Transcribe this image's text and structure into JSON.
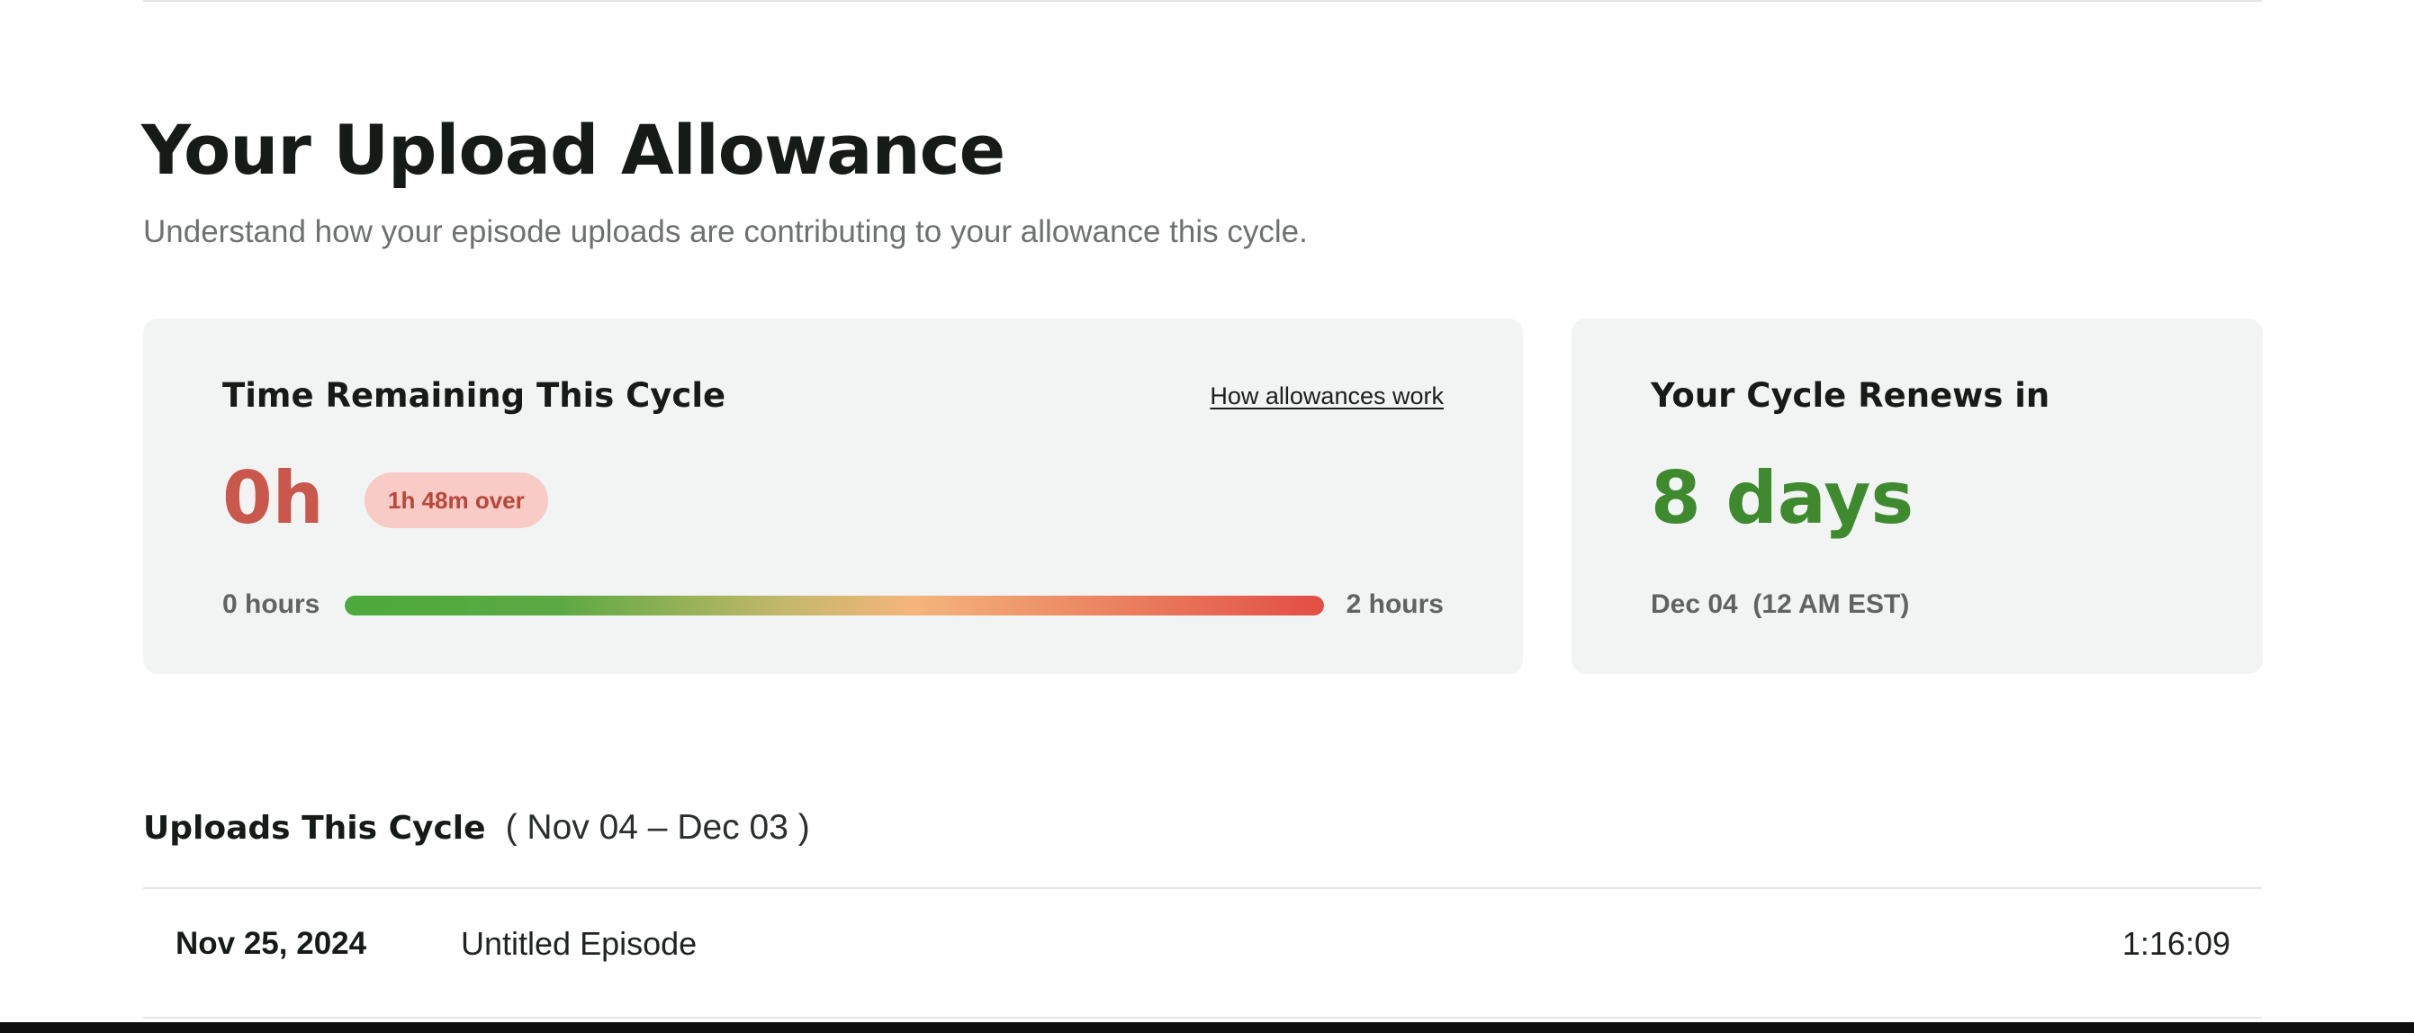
{
  "header": {
    "title": "Your Upload Allowance",
    "subtitle": "Understand how your episode uploads are contributing to your allowance this cycle."
  },
  "time_card": {
    "heading": "Time Remaining This Cycle",
    "help_link": "How allowances work",
    "remaining_value": "0h",
    "over_badge": "1h 48m over",
    "bar_min_label": "0 hours",
    "bar_max_label": "2 hours",
    "usage_fraction": 1.0,
    "value_color": "#c9574b",
    "badge_color": "#f8cbc6"
  },
  "cycle_card": {
    "heading": "Your Cycle Renews in",
    "renew_value": "8 days",
    "renew_date": "Dec 04  (12 AM EST)",
    "value_color": "#3f8a2e"
  },
  "uploads": {
    "title": "Uploads This Cycle",
    "range": "( Nov 04 – Dec 03 )",
    "rows": [
      {
        "date": "Nov 25, 2024",
        "title": "Untitled Episode",
        "duration": "1:16:09"
      }
    ]
  }
}
